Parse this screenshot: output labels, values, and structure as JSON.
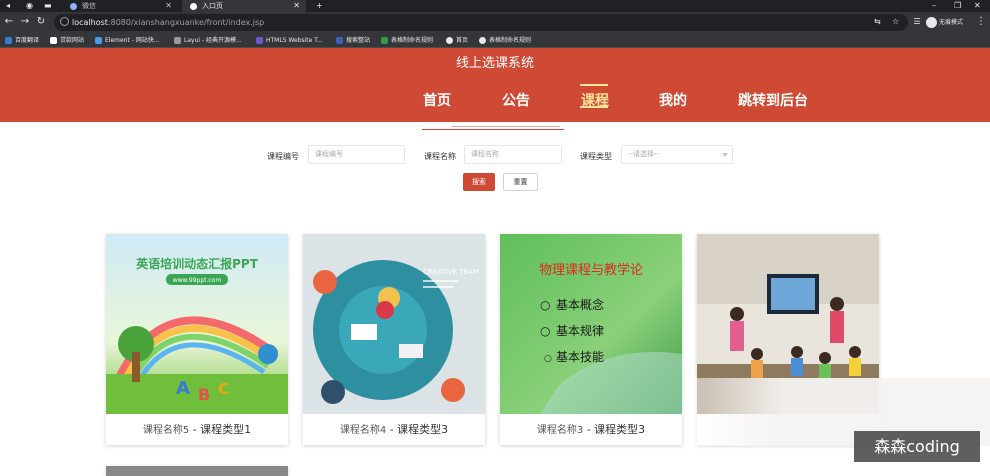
{
  "browser": {
    "tabs": [
      {
        "label": "微信"
      },
      {
        "label": "入口页"
      }
    ],
    "url": {
      "host": "localhost",
      "rest": ":8080/xianshangxuanke/front/index.jsp"
    },
    "profile_label": "无痕模式",
    "bookmarks": [
      {
        "label": "百度翻译",
        "color": "#3b7bd4"
      },
      {
        "label": "贷款网站",
        "color": "#ffffff"
      },
      {
        "label": "Element - 网站快...",
        "color": "#4aa0e6"
      },
      {
        "label": "Layui - 经典开源模...",
        "color": "#999999"
      },
      {
        "label": "HTML5 Website T...",
        "color": "#6a5acd"
      },
      {
        "label": "搜索整站",
        "color": "#3b62b5"
      },
      {
        "label": "表格制命名规则",
        "color": "#2e9e4f"
      },
      {
        "label": "首页",
        "color": "#e8eaed"
      },
      {
        "label": "表格制命名规则",
        "color": "#e8eaed"
      }
    ]
  },
  "site": {
    "title": "线上选课系统",
    "nav": [
      {
        "label": "首页"
      },
      {
        "label": "公告"
      },
      {
        "label": "课程"
      },
      {
        "label": "我的"
      },
      {
        "label": "跳转到后台"
      }
    ],
    "active_nav": "课程",
    "accent_color": "#cf4a34"
  },
  "search": {
    "course_no_label": "课程编号",
    "course_no_placeholder": "课程编号",
    "course_name_label": "课程名称",
    "course_name_placeholder": "课程名称",
    "course_type_label": "课程类型",
    "course_type_value": "--请选择--",
    "search_button": "搜索",
    "reset_button": "重置"
  },
  "cards": [
    {
      "name": "课程名称5",
      "sep": " - ",
      "type": "课程类型1",
      "image_title": "英语培训动态汇报PPT",
      "image_site": "www.99ppt.com"
    },
    {
      "name": "课程名称4",
      "sep": " - ",
      "type": "课程类型3",
      "image_title": "CREATIVE TEAM"
    },
    {
      "name": "课程名称3",
      "sep": " - ",
      "type": "课程类型3",
      "image_title": "物理课程与教学论",
      "bullets": [
        "基本概念",
        "基本规律",
        "基本技能"
      ]
    },
    {
      "name": "",
      "sep": "",
      "type": ""
    }
  ],
  "watermark": "森森coding"
}
